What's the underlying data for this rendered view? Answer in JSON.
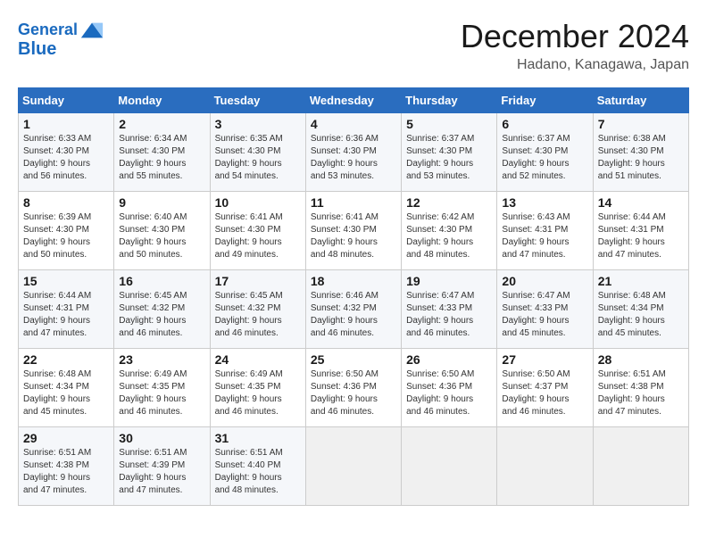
{
  "header": {
    "logo_line1": "General",
    "logo_line2": "Blue",
    "month_year": "December 2024",
    "location": "Hadano, Kanagawa, Japan"
  },
  "days_of_week": [
    "Sunday",
    "Monday",
    "Tuesday",
    "Wednesday",
    "Thursday",
    "Friday",
    "Saturday"
  ],
  "weeks": [
    [
      {
        "day": "1",
        "sunrise": "6:33 AM",
        "sunset": "4:30 PM",
        "daylight": "9 hours and 56 minutes."
      },
      {
        "day": "2",
        "sunrise": "6:34 AM",
        "sunset": "4:30 PM",
        "daylight": "9 hours and 55 minutes."
      },
      {
        "day": "3",
        "sunrise": "6:35 AM",
        "sunset": "4:30 PM",
        "daylight": "9 hours and 54 minutes."
      },
      {
        "day": "4",
        "sunrise": "6:36 AM",
        "sunset": "4:30 PM",
        "daylight": "9 hours and 53 minutes."
      },
      {
        "day": "5",
        "sunrise": "6:37 AM",
        "sunset": "4:30 PM",
        "daylight": "9 hours and 53 minutes."
      },
      {
        "day": "6",
        "sunrise": "6:37 AM",
        "sunset": "4:30 PM",
        "daylight": "9 hours and 52 minutes."
      },
      {
        "day": "7",
        "sunrise": "6:38 AM",
        "sunset": "4:30 PM",
        "daylight": "9 hours and 51 minutes."
      }
    ],
    [
      {
        "day": "8",
        "sunrise": "6:39 AM",
        "sunset": "4:30 PM",
        "daylight": "9 hours and 50 minutes."
      },
      {
        "day": "9",
        "sunrise": "6:40 AM",
        "sunset": "4:30 PM",
        "daylight": "9 hours and 50 minutes."
      },
      {
        "day": "10",
        "sunrise": "6:41 AM",
        "sunset": "4:30 PM",
        "daylight": "9 hours and 49 minutes."
      },
      {
        "day": "11",
        "sunrise": "6:41 AM",
        "sunset": "4:30 PM",
        "daylight": "9 hours and 48 minutes."
      },
      {
        "day": "12",
        "sunrise": "6:42 AM",
        "sunset": "4:30 PM",
        "daylight": "9 hours and 48 minutes."
      },
      {
        "day": "13",
        "sunrise": "6:43 AM",
        "sunset": "4:31 PM",
        "daylight": "9 hours and 47 minutes."
      },
      {
        "day": "14",
        "sunrise": "6:44 AM",
        "sunset": "4:31 PM",
        "daylight": "9 hours and 47 minutes."
      }
    ],
    [
      {
        "day": "15",
        "sunrise": "6:44 AM",
        "sunset": "4:31 PM",
        "daylight": "9 hours and 47 minutes."
      },
      {
        "day": "16",
        "sunrise": "6:45 AM",
        "sunset": "4:32 PM",
        "daylight": "9 hours and 46 minutes."
      },
      {
        "day": "17",
        "sunrise": "6:45 AM",
        "sunset": "4:32 PM",
        "daylight": "9 hours and 46 minutes."
      },
      {
        "day": "18",
        "sunrise": "6:46 AM",
        "sunset": "4:32 PM",
        "daylight": "9 hours and 46 minutes."
      },
      {
        "day": "19",
        "sunrise": "6:47 AM",
        "sunset": "4:33 PM",
        "daylight": "9 hours and 46 minutes."
      },
      {
        "day": "20",
        "sunrise": "6:47 AM",
        "sunset": "4:33 PM",
        "daylight": "9 hours and 45 minutes."
      },
      {
        "day": "21",
        "sunrise": "6:48 AM",
        "sunset": "4:34 PM",
        "daylight": "9 hours and 45 minutes."
      }
    ],
    [
      {
        "day": "22",
        "sunrise": "6:48 AM",
        "sunset": "4:34 PM",
        "daylight": "9 hours and 45 minutes."
      },
      {
        "day": "23",
        "sunrise": "6:49 AM",
        "sunset": "4:35 PM",
        "daylight": "9 hours and 46 minutes."
      },
      {
        "day": "24",
        "sunrise": "6:49 AM",
        "sunset": "4:35 PM",
        "daylight": "9 hours and 46 minutes."
      },
      {
        "day": "25",
        "sunrise": "6:50 AM",
        "sunset": "4:36 PM",
        "daylight": "9 hours and 46 minutes."
      },
      {
        "day": "26",
        "sunrise": "6:50 AM",
        "sunset": "4:36 PM",
        "daylight": "9 hours and 46 minutes."
      },
      {
        "day": "27",
        "sunrise": "6:50 AM",
        "sunset": "4:37 PM",
        "daylight": "9 hours and 46 minutes."
      },
      {
        "day": "28",
        "sunrise": "6:51 AM",
        "sunset": "4:38 PM",
        "daylight": "9 hours and 47 minutes."
      }
    ],
    [
      {
        "day": "29",
        "sunrise": "6:51 AM",
        "sunset": "4:38 PM",
        "daylight": "9 hours and 47 minutes."
      },
      {
        "day": "30",
        "sunrise": "6:51 AM",
        "sunset": "4:39 PM",
        "daylight": "9 hours and 47 minutes."
      },
      {
        "day": "31",
        "sunrise": "6:51 AM",
        "sunset": "4:40 PM",
        "daylight": "9 hours and 48 minutes."
      },
      null,
      null,
      null,
      null
    ]
  ],
  "labels": {
    "sunrise": "Sunrise:",
    "sunset": "Sunset:",
    "daylight": "Daylight:"
  }
}
